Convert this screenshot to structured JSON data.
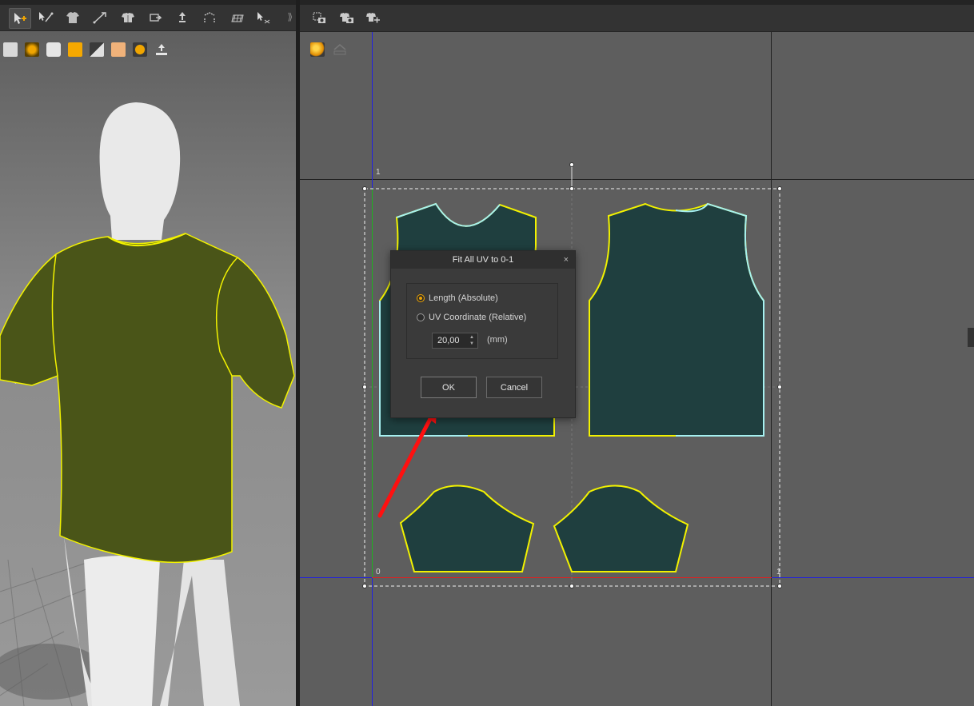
{
  "left_toolbar": {
    "row1_tools": [
      "move-tool",
      "edit-pattern-tool",
      "garment-tool",
      "sewing-tool",
      "fold-tool",
      "transform-tool",
      "avatar-tool",
      "pin-tool",
      "grid-tool",
      "select-mesh-tool"
    ],
    "row2_tools": [
      "shirt-icon",
      "colorway-icon",
      "avatar-icon",
      "texture-icon",
      "fabric-icon",
      "skin-icon",
      "globe-icon",
      "export-icon"
    ],
    "overflow": "⟫"
  },
  "right_toolbar": {
    "tools": [
      "uv-snapshot-tool",
      "uv-camera-tool",
      "uv-arrange-tool"
    ],
    "view_tools": [
      "shading-sphere-icon",
      "uv-home-icon"
    ]
  },
  "uv_labels": {
    "top_left": "1",
    "bottom_left": "0",
    "bottom_right": "1"
  },
  "dialog": {
    "title": "Fit All UV to 0-1",
    "close": "×",
    "option_length": "Length (Absolute)",
    "option_uv": "UV Coordinate (Relative)",
    "selected_option": "Length (Absolute)",
    "spin_value": "20,00",
    "unit": "(mm)",
    "ok_label": "OK",
    "cancel_label": "Cancel"
  },
  "colors": {
    "garment_3d": "#4a5518",
    "pattern_fill": "#1f3f3f",
    "outline_yellow": "#f2f200",
    "outline_cyan": "#a6f0f0",
    "axis_blue": "#2020e0",
    "axis_green": "#20b020",
    "axis_red": "#e02020",
    "radio_accent": "#f0a500",
    "arrow_red": "#ff1010"
  }
}
